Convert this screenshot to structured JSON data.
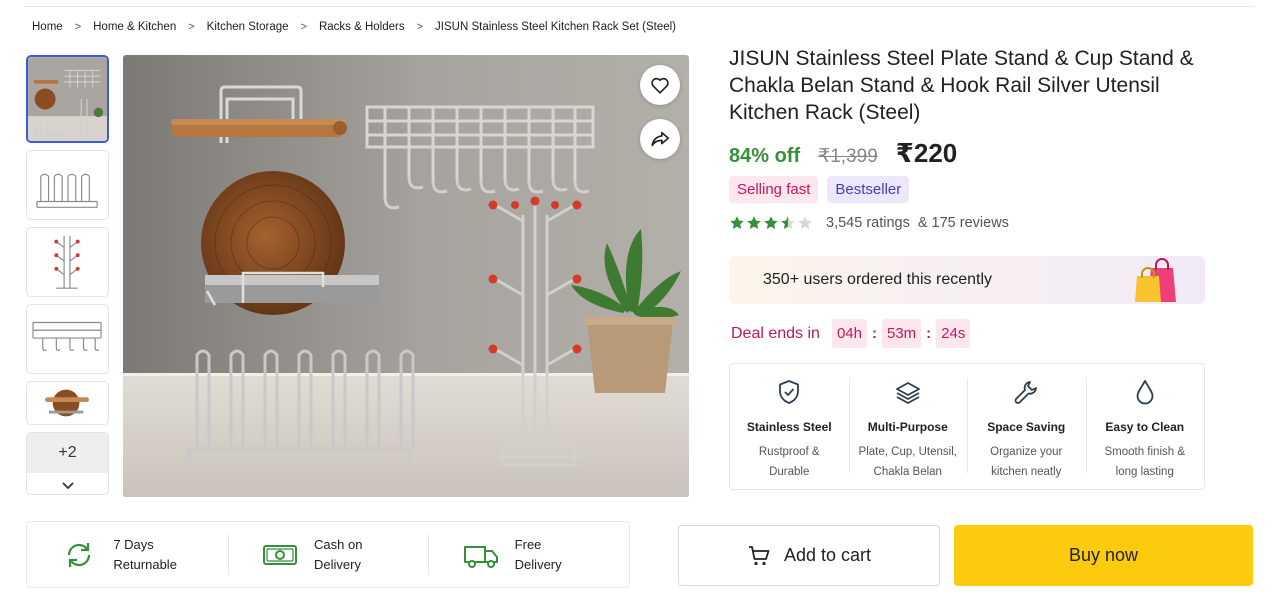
{
  "breadcrumb": [
    "Home",
    "Home & Kitchen",
    "Kitchen Storage",
    "Racks & Holders",
    "JISUN Stainless Steel Kitchen Rack Set (Steel)"
  ],
  "gallery": {
    "more_count": "+2",
    "thumbnails": [
      "full-set-thumbnail",
      "plate-rack-thumbnail",
      "cup-stand-thumbnail",
      "hook-rail-thumbnail",
      "chakla-belan-thumbnail"
    ],
    "icons": {
      "wishlist": "heart-icon",
      "share": "share-icon",
      "more": "chevron-down-icon"
    }
  },
  "product": {
    "title": "JISUN Stainless Steel Plate Stand & Cup Stand & Chakla Belan Stand & Hook Rail Silver Utensil Kitchen Rack (Steel)",
    "discount": "84% off",
    "mrp": "₹1,399",
    "price": "₹220",
    "tags": [
      "Selling fast",
      "Bestseller"
    ],
    "rating": {
      "stars": 3.5,
      "ratings": "3,545 ratings",
      "reviews": "& 175 reviews"
    },
    "ordered_recently": "350+ users ordered this recently"
  },
  "deal": {
    "label": "Deal ends in",
    "hours": "04h",
    "minutes": "53m",
    "seconds": "24s"
  },
  "features": [
    {
      "icon": "shield-check-icon",
      "title": "Stainless Steel",
      "desc": "Rustproof & Durable"
    },
    {
      "icon": "layers-icon",
      "title": "Multi-Purpose",
      "desc": "Plate, Cup, Utensil, Chakla Belan"
    },
    {
      "icon": "wrench-icon",
      "title": "Space Saving",
      "desc": "Organize your kitchen neatly"
    },
    {
      "icon": "droplet-icon",
      "title": "Easy to Clean",
      "desc": "Smooth finish & long lasting"
    }
  ],
  "services": [
    {
      "icon": "return-icon",
      "line1": "7 Days",
      "line2": "Returnable"
    },
    {
      "icon": "cash-icon",
      "line1": "Cash on",
      "line2": "Delivery"
    },
    {
      "icon": "truck-icon",
      "line1": "Free",
      "line2": "Delivery"
    }
  ],
  "actions": {
    "add_to_cart": "Add to cart",
    "buy_now": "Buy now"
  },
  "colors": {
    "discount_green": "#388e3c",
    "accent_pink": "#c2185b",
    "buy_yellow": "#fccb0e",
    "star_green": "#388e3c",
    "thumb_active": "#3b5bdb"
  }
}
